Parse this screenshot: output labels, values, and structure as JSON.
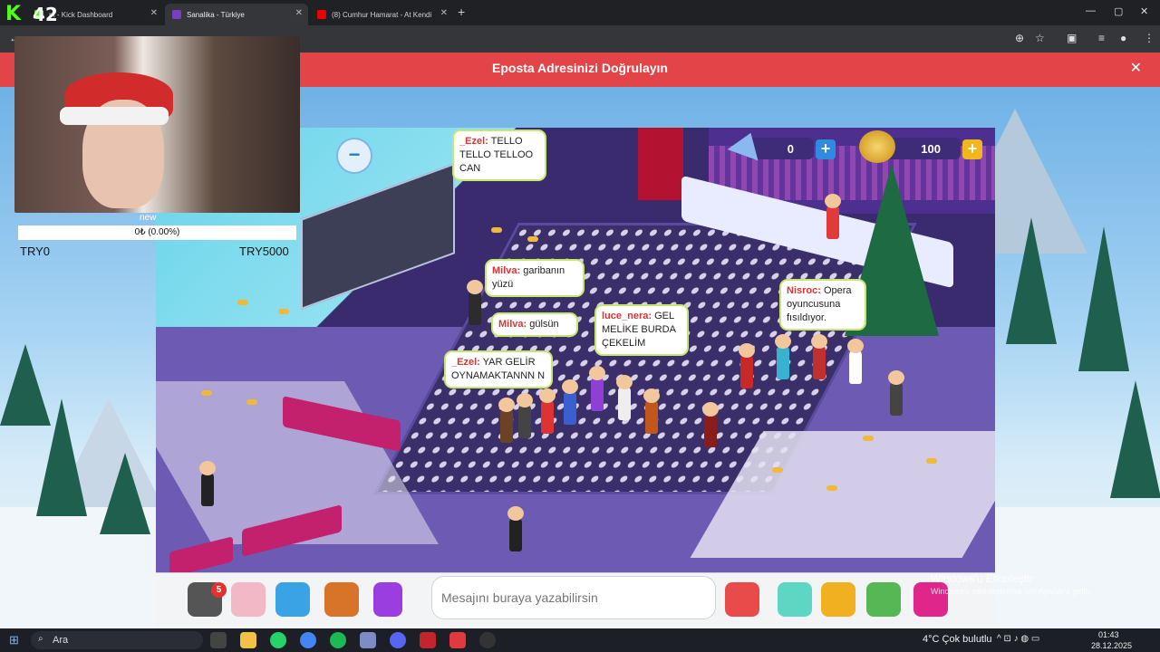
{
  "browser": {
    "tabs": [
      {
        "title": "m - Kick Dashboard",
        "active": false,
        "favicon_color": "#53fc18"
      },
      {
        "title": "Sanalika - Türkiye",
        "active": true,
        "favicon_color": "#7a3fc0"
      },
      {
        "title": "(8) Cumhur Hamarat - At Kendi",
        "active": false,
        "favicon_color": "#e00"
      }
    ],
    "new_tab": "+",
    "window_controls": [
      "—",
      "▢",
      "✕"
    ]
  },
  "banner": {
    "title": "Eposta Adresinizi Doğrulayın",
    "close": "✕",
    "color": "#e24447"
  },
  "game": {
    "currency": {
      "diamonds": "0",
      "coins": "100",
      "plus": "+"
    },
    "zoom_out": "−",
    "chat_bubbles": [
      {
        "user": "_Ezel:",
        "text": " TELLO TELLO TELLOO CAN"
      },
      {
        "user": "Milva:",
        "text": " garibanın yüzü"
      },
      {
        "user": "Milva:",
        "text": " gülsün"
      },
      {
        "user": "luce_nera:",
        "text": " GEL MELİKE BURDA ÇEKELİM"
      },
      {
        "user": "_Ezel:",
        "text": " YAR GELİR OYNAMAKTANNN N"
      },
      {
        "user": "Nisroc:",
        "text": " Opera oyuncusuna fısıldıyor."
      }
    ],
    "bottom_bar": {
      "notification_count": "5",
      "message_placeholder": "Mesajını buraya yazabilirsin",
      "tool_icons": [
        "phone-icon",
        "friends-icon",
        "wardrobe-icon",
        "backpack-icon",
        "dance-icon",
        "chat-bubbles-icon",
        "emoji-icon",
        "trophy-icon",
        "island-icon",
        "vip-icon"
      ]
    }
  },
  "stream_overlay": {
    "logo_k": "K",
    "logo_num": "42",
    "goal_label": "new",
    "goal_progress": "0₺ (0.00%)",
    "goal_min": "TRY0",
    "goal_max": "TRY5000"
  },
  "windows_watermark": {
    "line1": "Windows'u Etkinleştir",
    "line2": "Windows'u etkinleştirmek için Ayarlar'a gidin."
  },
  "taskbar": {
    "search_placeholder": "Ara",
    "weather": "4°C  Çok bulutlu",
    "time": "01:43",
    "date": "28.12.2025"
  }
}
